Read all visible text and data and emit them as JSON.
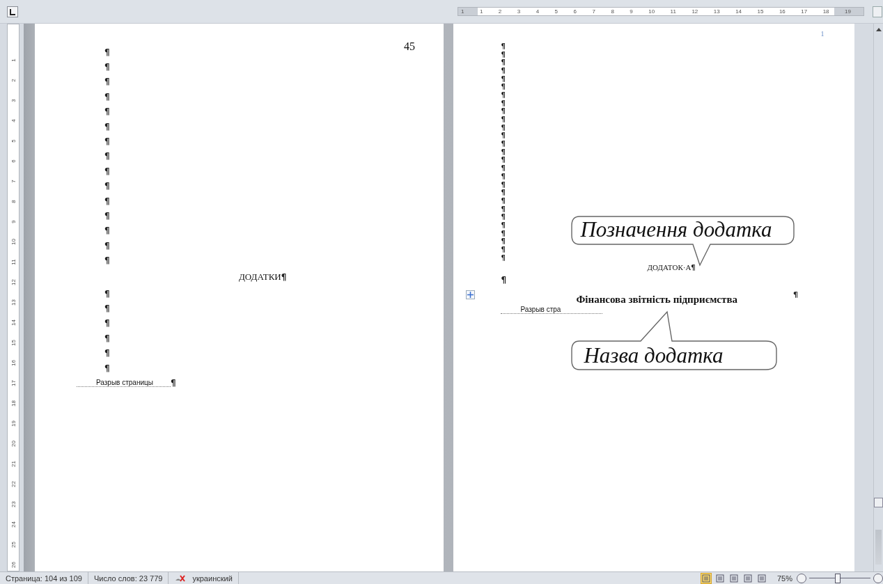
{
  "ruler": {
    "horizontal": [
      "1",
      "1",
      "2",
      "3",
      "4",
      "5",
      "6",
      "7",
      "8",
      "9",
      "10",
      "11",
      "12",
      "13",
      "14",
      "15",
      "16",
      "17",
      "18",
      "19"
    ],
    "vertical": [
      "1",
      "2",
      "3",
      "4",
      "5",
      "6",
      "7",
      "8",
      "9",
      "10",
      "11",
      "12",
      "13",
      "14",
      "15",
      "16",
      "17",
      "18",
      "19",
      "20",
      "21",
      "22",
      "23",
      "24",
      "25",
      "26"
    ]
  },
  "pages": [
    {
      "page_number": "45",
      "blocks": [
        {
          "kind": "empty",
          "mark": "¶"
        },
        {
          "kind": "empty",
          "mark": "¶"
        },
        {
          "kind": "empty",
          "mark": "¶"
        },
        {
          "kind": "empty",
          "mark": "¶"
        },
        {
          "kind": "empty",
          "mark": "¶"
        },
        {
          "kind": "empty",
          "mark": "¶"
        },
        {
          "kind": "empty",
          "mark": "¶"
        },
        {
          "kind": "empty",
          "mark": "¶"
        },
        {
          "kind": "empty",
          "mark": "¶"
        },
        {
          "kind": "empty",
          "mark": "¶"
        },
        {
          "kind": "empty",
          "mark": "¶"
        },
        {
          "kind": "empty",
          "mark": "¶"
        },
        {
          "kind": "empty",
          "mark": "¶"
        },
        {
          "kind": "empty",
          "mark": "¶"
        },
        {
          "kind": "empty",
          "mark": "¶"
        },
        {
          "kind": "heading",
          "text": "ДОДАТКИ",
          "mark": "¶"
        },
        {
          "kind": "empty",
          "mark": "¶"
        },
        {
          "kind": "empty",
          "mark": "¶"
        },
        {
          "kind": "empty",
          "mark": "¶"
        },
        {
          "kind": "empty",
          "mark": "¶"
        },
        {
          "kind": "empty",
          "mark": "¶"
        },
        {
          "kind": "empty",
          "mark": "¶"
        },
        {
          "kind": "page_break",
          "text": "Разрыв страницы",
          "mark": "¶"
        }
      ]
    },
    {
      "page_number": "1",
      "blocks": [
        {
          "kind": "small",
          "mark": "¶"
        },
        {
          "kind": "small",
          "mark": "¶"
        },
        {
          "kind": "small",
          "mark": "¶"
        },
        {
          "kind": "small",
          "mark": "¶"
        },
        {
          "kind": "small",
          "mark": "¶"
        },
        {
          "kind": "small",
          "mark": "¶"
        },
        {
          "kind": "small",
          "mark": "¶"
        },
        {
          "kind": "small",
          "mark": "¶"
        },
        {
          "kind": "small",
          "mark": "¶"
        },
        {
          "kind": "small",
          "mark": "¶"
        },
        {
          "kind": "small",
          "mark": "¶"
        },
        {
          "kind": "small",
          "mark": "¶"
        },
        {
          "kind": "small",
          "mark": "¶"
        },
        {
          "kind": "small",
          "mark": "¶"
        },
        {
          "kind": "small",
          "mark": "¶"
        },
        {
          "kind": "small",
          "mark": "¶"
        },
        {
          "kind": "small",
          "mark": "¶"
        },
        {
          "kind": "small",
          "mark": "¶"
        },
        {
          "kind": "small",
          "mark": "¶"
        },
        {
          "kind": "small",
          "mark": "¶"
        },
        {
          "kind": "small",
          "mark": "¶"
        },
        {
          "kind": "small",
          "mark": "¶"
        },
        {
          "kind": "small",
          "mark": "¶"
        },
        {
          "kind": "small",
          "mark": "¶"
        },
        {
          "kind": "small",
          "mark": "¶"
        },
        {
          "kind": "small",
          "mark": "¶"
        },
        {
          "kind": "small",
          "mark": "¶"
        },
        {
          "kind": "label",
          "text": "ДОДАТОК·А",
          "mark": "¶"
        },
        {
          "kind": "empty",
          "mark": "¶"
        },
        {
          "kind": "table_row",
          "text": "Фінансова звітність підприємства",
          "mark": "¶"
        },
        {
          "kind": "page_break",
          "text": "Разрыв стра"
        }
      ],
      "callouts": [
        {
          "text": "Позначення додатка",
          "kind": "down"
        },
        {
          "text": "Назва додатка",
          "kind": "up"
        }
      ]
    }
  ],
  "status_bar": {
    "page": "Страница: 104 из 109",
    "words": "Число слов: 23 779",
    "language": "украинский",
    "views": [
      {
        "selected": true
      },
      {
        "selected": false
      },
      {
        "selected": false
      },
      {
        "selected": false
      },
      {
        "selected": false
      }
    ],
    "zoom": "75%",
    "zoom_slider": {
      "level": 0.45
    }
  }
}
